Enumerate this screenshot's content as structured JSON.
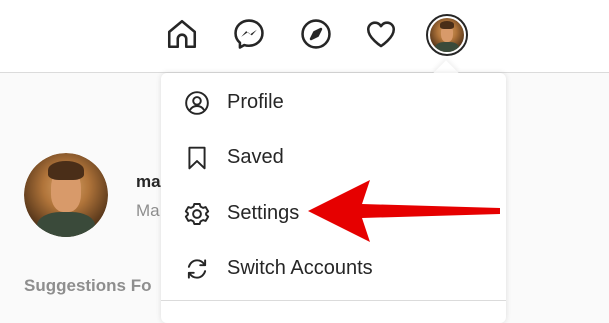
{
  "topbar": {
    "icons": [
      "home-icon",
      "messenger-icon",
      "explore-compass-icon",
      "heart-icon",
      "profile-avatar"
    ]
  },
  "sidebar_profile": {
    "username_partial": "ma",
    "subtitle_partial": "Ma"
  },
  "suggestions_label": "Suggestions Fo",
  "menu": {
    "items": [
      {
        "label": "Profile",
        "icon": "profile-circle-icon"
      },
      {
        "label": "Saved",
        "icon": "bookmark-icon"
      },
      {
        "label": "Settings",
        "icon": "gear-icon"
      },
      {
        "label": "Switch Accounts",
        "icon": "switch-arrows-icon"
      }
    ]
  },
  "colors": {
    "text": "#262626",
    "muted": "#8e8e8e",
    "border": "#dbdbdb",
    "annotation_arrow": "#e60000"
  }
}
